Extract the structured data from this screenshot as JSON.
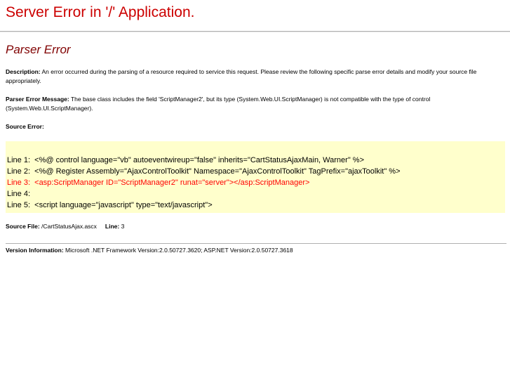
{
  "page": {
    "app_title": "Server Error in '/' Application.",
    "error_heading": "Parser Error"
  },
  "description": {
    "label": "Description:",
    "text": "An error occurred during the parsing of a resource required to service this request. Please review the following specific parse error details and modify your source file appropriately."
  },
  "parser_message": {
    "label": "Parser Error Message:",
    "text": "The base class includes the field 'ScriptManager2', but its type (System.Web.UI.ScriptManager) is not compatible with the type of control (System.Web.UI.ScriptManager)."
  },
  "source_error": {
    "label": "Source Error:",
    "lines": [
      "Line 1:  <%@ control language=\"vb\" autoeventwireup=\"false\" inherits=\"CartStatusAjaxMain, Warner\" %>",
      "Line 2:  <%@ Register Assembly=\"AjaxControlToolkit\" Namespace=\"AjaxControlToolkit\" TagPrefix=\"ajaxToolkit\" %>",
      "Line 3:  <asp:ScriptManager ID=\"ScriptManager2\" runat=\"server\"></asp:ScriptManager>",
      "Line 4: ",
      "Line 5:  <script language=\"javascript\" type=\"text/javascript\">"
    ],
    "error_line_color": "#ff0000",
    "box_color": "#ffffcc"
  },
  "source_file": {
    "label": "Source File:",
    "value": "/CartStatusAjax.ascx",
    "line_label": "Line:",
    "line_value": "3"
  },
  "version": {
    "label": "Version Information:",
    "text": "Microsoft .NET Framework Version:2.0.50727.3620; ASP.NET Version:2.0.50727.3618"
  },
  "colors": {
    "title": "#cc0000",
    "heading": "#800000"
  }
}
